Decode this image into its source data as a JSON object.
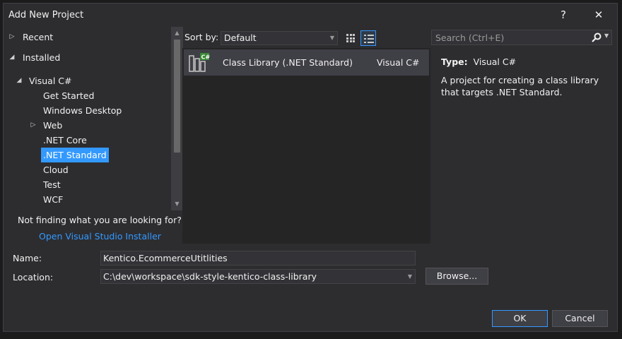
{
  "window": {
    "title": "Add New Project",
    "help_label": "?",
    "close_label": "✕"
  },
  "tree": {
    "recent": "Recent",
    "installed": "Installed",
    "visual_csharp": "Visual C#",
    "items": [
      "Get Started",
      "Windows Desktop",
      "Web",
      ".NET Core",
      ".NET Standard",
      "Cloud",
      "Test",
      "WCF"
    ],
    "selected": ".NET Standard"
  },
  "not_finding": "Not finding what you are looking for?",
  "installer_link": "Open Visual Studio Installer",
  "sort": {
    "label": "Sort by:",
    "value": "Default"
  },
  "templates": [
    {
      "name": "Class Library (.NET Standard)",
      "language": "Visual C#"
    }
  ],
  "search": {
    "placeholder": "Search (Ctrl+E)"
  },
  "details": {
    "type_label": "Type:",
    "type_value": "Visual C#",
    "description": "A project for creating a class library that targets .NET Standard."
  },
  "form": {
    "name_label": "Name:",
    "name_value": "Kentico.EcommerceUtitlities",
    "location_label": "Location:",
    "location_value": "C:\\dev\\workspace\\sdk-style-kentico-class-library",
    "browse_label": "Browse...",
    "ok_label": "OK",
    "cancel_label": "Cancel"
  },
  "colors": {
    "accent": "#3399ff",
    "background": "#2d2d30",
    "panel": "#252526",
    "selected_item": "#3f3f46"
  }
}
